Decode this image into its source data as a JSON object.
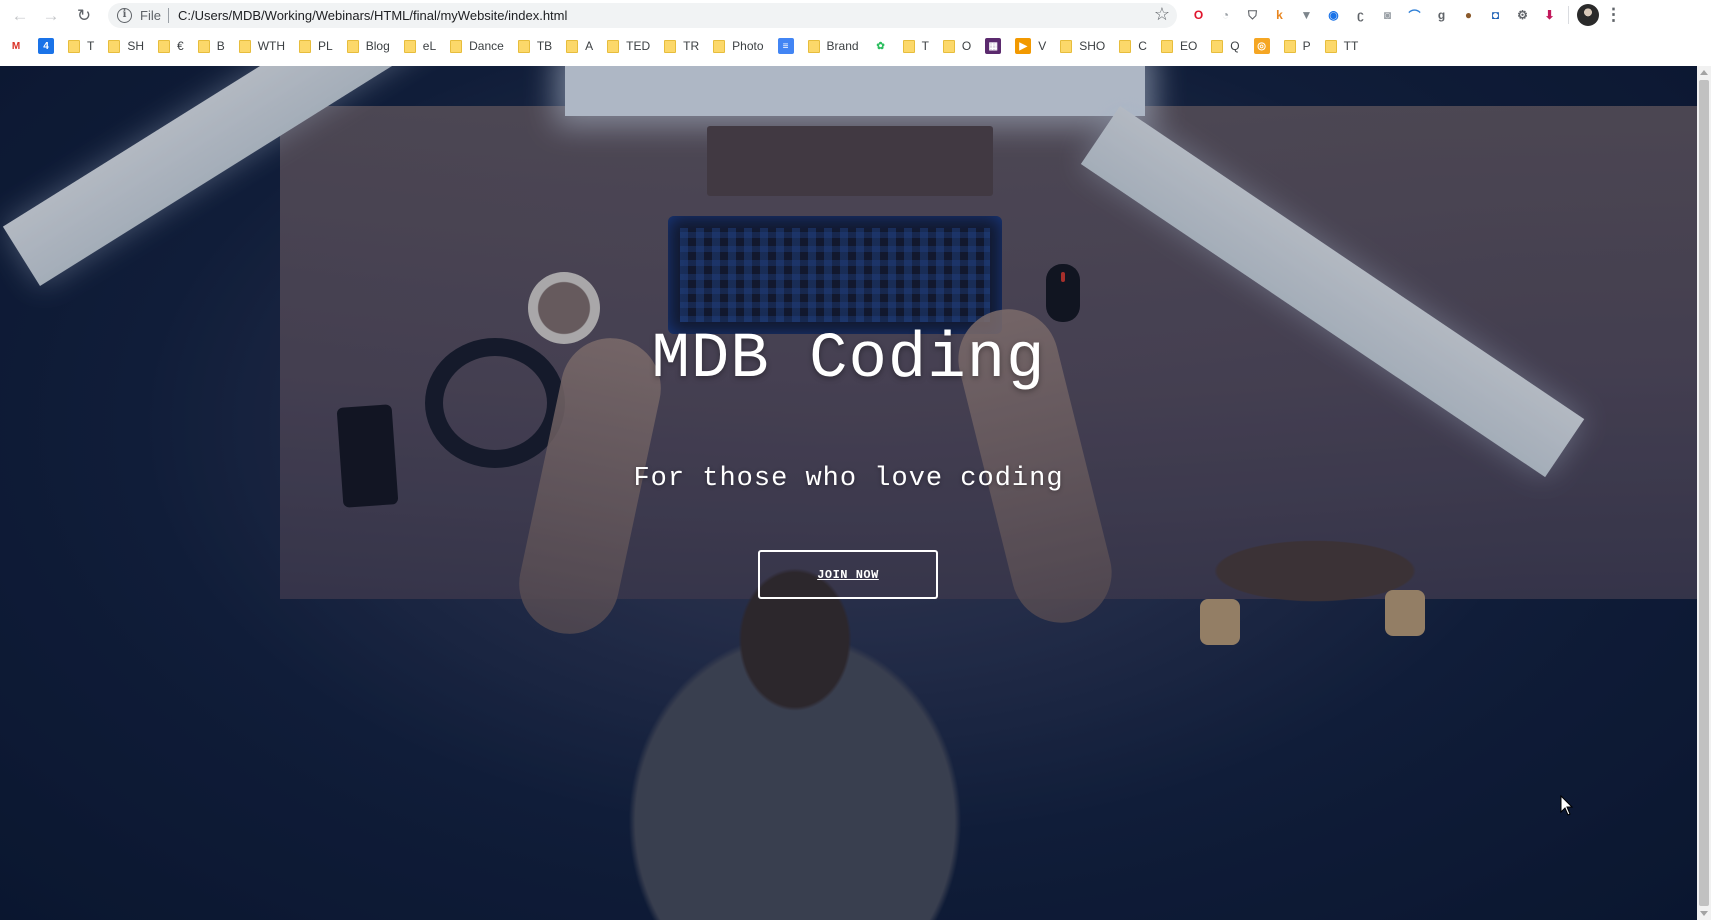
{
  "browser": {
    "address": {
      "scheme_label": "File",
      "url": "C:/Users/MDB/Working/Webinars/HTML/final/myWebsite/index.html"
    },
    "extensions": [
      {
        "icon": "opera-icon",
        "glyph": "O",
        "color": "#e0142c"
      },
      {
        "icon": "clock-extension-icon",
        "glyph": "◔",
        "color": "#9aa0a6"
      },
      {
        "icon": "pocket-icon",
        "glyph": "⛉",
        "color": "#5f6368"
      },
      {
        "icon": "k-extension-icon",
        "glyph": "k",
        "color": "#e8851f"
      },
      {
        "icon": "v-extension-icon",
        "glyph": "▼",
        "color": "#7d858c"
      },
      {
        "icon": "globe-extension-icon",
        "glyph": "◉",
        "color": "#1a73e8"
      },
      {
        "icon": "c-extension-icon",
        "glyph": "ʗ",
        "color": "#5f6368"
      },
      {
        "icon": "camera-icon",
        "glyph": "◙",
        "color": "#9aa0a6"
      },
      {
        "icon": "wave-extension-icon",
        "glyph": "⌒",
        "color": "#2f7fd6"
      },
      {
        "icon": "g-extension-icon",
        "glyph": "g",
        "color": "#5f6368"
      },
      {
        "icon": "cookie-icon",
        "glyph": "●",
        "color": "#8b5a2b"
      },
      {
        "icon": "frame-extension-icon",
        "glyph": "◘",
        "color": "#1a5fb4"
      },
      {
        "icon": "gear-extension-icon",
        "glyph": "⚙",
        "color": "#5f6368"
      },
      {
        "icon": "download-extension-icon",
        "glyph": "⬇",
        "color": "#c2185b"
      }
    ]
  },
  "bookmarks": [
    {
      "kind": "favicon",
      "icon": "gmail-icon",
      "glyph": "M",
      "color": "#ffffff",
      "text_color": "#d93025",
      "label": ""
    },
    {
      "kind": "favicon",
      "icon": "calendar-icon",
      "glyph": "4",
      "color": "#1a73e8",
      "text_color": "#ffffff",
      "label": ""
    },
    {
      "kind": "folder",
      "icon": "folder-icon",
      "label": "T"
    },
    {
      "kind": "folder",
      "icon": "folder-icon",
      "label": "SH"
    },
    {
      "kind": "folder",
      "icon": "folder-icon",
      "label": "€"
    },
    {
      "kind": "folder",
      "icon": "folder-icon",
      "label": "B"
    },
    {
      "kind": "folder",
      "icon": "folder-icon",
      "label": "WTH"
    },
    {
      "kind": "folder",
      "icon": "folder-icon",
      "label": "PL"
    },
    {
      "kind": "folder",
      "icon": "folder-icon",
      "label": "Blog"
    },
    {
      "kind": "folder",
      "icon": "folder-icon",
      "label": "eL"
    },
    {
      "kind": "folder",
      "icon": "folder-icon",
      "label": "Dance"
    },
    {
      "kind": "folder",
      "icon": "folder-icon",
      "label": "TB"
    },
    {
      "kind": "folder",
      "icon": "folder-icon",
      "label": "A"
    },
    {
      "kind": "folder",
      "icon": "folder-icon",
      "label": "TED"
    },
    {
      "kind": "folder",
      "icon": "folder-icon",
      "label": "TR"
    },
    {
      "kind": "folder",
      "icon": "folder-icon",
      "label": "Photo"
    },
    {
      "kind": "favicon",
      "icon": "docs-icon",
      "glyph": "≡",
      "color": "#4285f4",
      "text_color": "#ffffff",
      "label": ""
    },
    {
      "kind": "folder",
      "icon": "folder-icon",
      "label": "Brand"
    },
    {
      "kind": "favicon",
      "icon": "evernote-icon",
      "glyph": "✿",
      "color": "#ffffff",
      "text_color": "#2dbe60",
      "label": ""
    },
    {
      "kind": "folder",
      "icon": "folder-icon",
      "label": "T"
    },
    {
      "kind": "folder",
      "icon": "folder-icon",
      "label": "O"
    },
    {
      "kind": "favicon",
      "icon": "grid-app-icon",
      "glyph": "▦",
      "color": "#5b2a6e",
      "text_color": "#ffffff",
      "label": ""
    },
    {
      "kind": "favicon",
      "icon": "play-icon",
      "glyph": "▶",
      "color": "#f29900",
      "text_color": "#ffffff",
      "label": "V"
    },
    {
      "kind": "folder",
      "icon": "folder-icon",
      "label": "SHO"
    },
    {
      "kind": "folder",
      "icon": "folder-icon",
      "label": "C"
    },
    {
      "kind": "folder",
      "icon": "folder-icon",
      "label": "EO"
    },
    {
      "kind": "folder",
      "icon": "folder-icon",
      "label": "Q"
    },
    {
      "kind": "favicon",
      "icon": "orange-app-icon",
      "glyph": "◎",
      "color": "#f5a623",
      "text_color": "#ffffff",
      "label": ""
    },
    {
      "kind": "folder",
      "icon": "folder-icon",
      "label": "P"
    },
    {
      "kind": "folder",
      "icon": "folder-icon",
      "label": "TT"
    }
  ],
  "hero": {
    "title": "MDB Coding",
    "subtitle": "For those who love coding",
    "cta_label": "JOIN NOW"
  }
}
